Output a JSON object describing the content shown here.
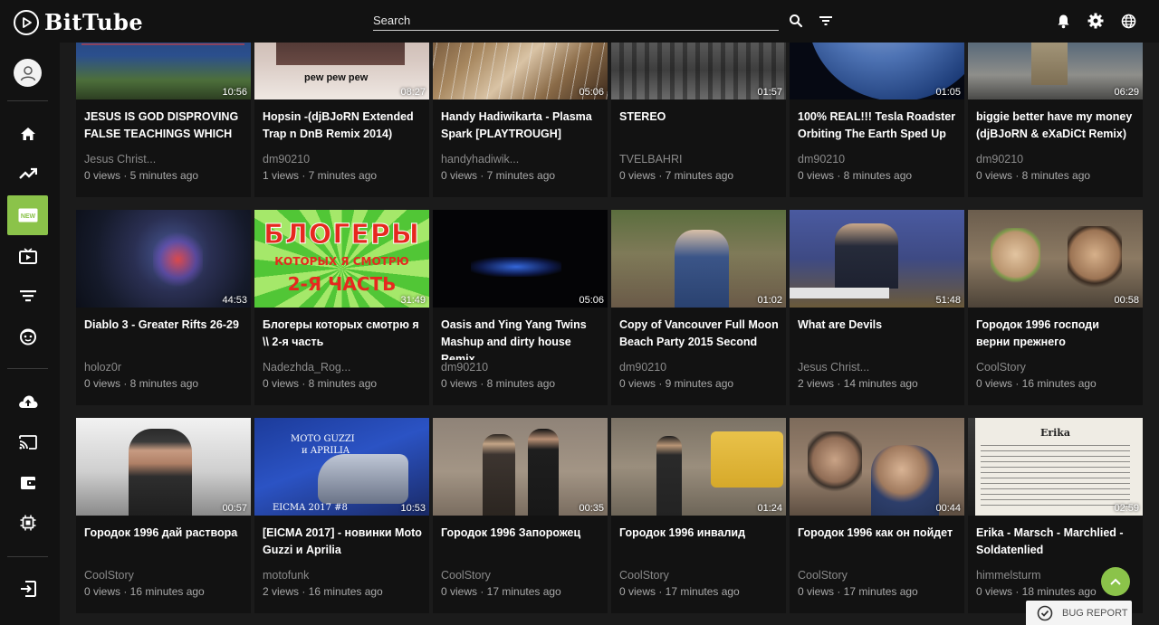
{
  "app": {
    "name": "BitTube"
  },
  "search": {
    "placeholder": "Search"
  },
  "icons": {
    "search": "search-icon",
    "filter": "filter-icon",
    "notifications": "bell-icon",
    "settings": "gear-icon",
    "language": "globe-icon"
  },
  "colors": {
    "accent": "#8bc34a",
    "background": "#1b1b1b",
    "card": "#121212",
    "topbar": "#121212"
  },
  "sidebar": {
    "items": [
      {
        "name": "home",
        "icon": "home-icon"
      },
      {
        "name": "trending",
        "icon": "trending-icon"
      },
      {
        "name": "new",
        "icon": "new-icon",
        "badge": "NEW",
        "active": true
      },
      {
        "name": "subscriptions",
        "icon": "tv-play-icon"
      },
      {
        "name": "filter",
        "icon": "filter-list-icon"
      },
      {
        "name": "kids",
        "icon": "face-icon"
      },
      {
        "name": "upload",
        "icon": "cloud-upload-icon"
      },
      {
        "name": "cast",
        "icon": "cast-icon"
      },
      {
        "name": "wallet",
        "icon": "wallet-icon"
      },
      {
        "name": "settings",
        "icon": "chip-icon"
      },
      {
        "name": "logout",
        "icon": "logout-icon"
      }
    ]
  },
  "videos": [
    {
      "title": "JESUS IS GOD DISPROVING FALSE TEACHINGS WHICH",
      "author": "Jesus Christ...",
      "meta": "0 views · 5 minutes ago",
      "duration": "10:56"
    },
    {
      "title": "Hopsin -(djBJoRN Extended Trap n DnB Remix 2014)",
      "author": "dm90210",
      "meta": "1 views · 7 minutes ago",
      "duration": "08:27"
    },
    {
      "title": "Handy Hadiwikarta - Plasma Spark [PLAYTROUGH]",
      "author": "handyhadiwik...",
      "meta": "0 views · 7 minutes ago",
      "duration": "05:06"
    },
    {
      "title": "STEREO",
      "author": "TVELBAHRI",
      "meta": "0 views · 7 minutes ago",
      "duration": "01:57"
    },
    {
      "title": "100% REAL!!! Tesla Roadster Orbiting The Earth Sped Up",
      "author": "dm90210",
      "meta": "0 views · 8 minutes ago",
      "duration": "01:05"
    },
    {
      "title": "biggie better have my money (djBJoRN & eXaDiCt Remix)",
      "author": "dm90210",
      "meta": "0 views · 8 minutes ago",
      "duration": "06:29"
    },
    {
      "title": "Diablo 3 - Greater Rifts 26-29",
      "author": "holoz0r",
      "meta": "0 views · 8 minutes ago",
      "duration": "44:53"
    },
    {
      "title": "Блогеры которых смотрю я \\\\ 2-я часть",
      "author": "Nadezhda_Rog...",
      "meta": "0 views · 8 minutes ago",
      "duration": "31:49"
    },
    {
      "title": "Oasis and Ying Yang Twins Mashup and dirty house Remix",
      "author": "dm90210",
      "meta": "0 views · 8 minutes ago",
      "duration": "05:06"
    },
    {
      "title": "Copy of Vancouver Full Moon Beach Party 2015 Second",
      "author": "dm90210",
      "meta": "0 views · 9 minutes ago",
      "duration": "01:02"
    },
    {
      "title": "What are Devils",
      "author": "Jesus Christ...",
      "meta": "2 views · 14 minutes ago",
      "duration": "51:48"
    },
    {
      "title": "Городок 1996 господи верни прежнего",
      "author": "CoolStory",
      "meta": "0 views · 16 minutes ago",
      "duration": "00:58"
    },
    {
      "title": "Городок 1996 дай раствора",
      "author": "CoolStory",
      "meta": "0 views · 16 minutes ago",
      "duration": "00:57"
    },
    {
      "title": "[EICMA 2017] - новинки Moto Guzzi и Aprilia",
      "author": "motofunk",
      "meta": "2 views · 16 minutes ago",
      "duration": "10:53"
    },
    {
      "title": "Городок 1996 Запорожец",
      "author": "CoolStory",
      "meta": "0 views · 17 minutes ago",
      "duration": "00:35"
    },
    {
      "title": "Городок 1996 инвалид",
      "author": "CoolStory",
      "meta": "0 views · 17 minutes ago",
      "duration": "01:24"
    },
    {
      "title": "Городок 1996 как он пойдет",
      "author": "CoolStory",
      "meta": "0 views · 17 minutes ago",
      "duration": "00:44"
    },
    {
      "title": "Erika - Marsch - Marchlied - Soldatenlied",
      "author": "himmelsturm",
      "meta": "0 views · 18 minutes ago",
      "duration": "02:59"
    }
  ],
  "thumb_text": {
    "v1": "pew pew pew",
    "v8_line1": "БЛОГЕРЫ",
    "v8_line2": "КОТОРЫХ Я СМОТРЮ",
    "v8_line3": "2-Я ЧАСТЬ",
    "v14_line1": "MOTO GUZZI",
    "v14_line2": "и APRILIA",
    "v14_line3": "EICMA 2017 #8",
    "v18": "Erika"
  },
  "bug_report": {
    "label": "BUG REPORT"
  },
  "scroll_top": {
    "icon": "chevron-up-icon"
  }
}
